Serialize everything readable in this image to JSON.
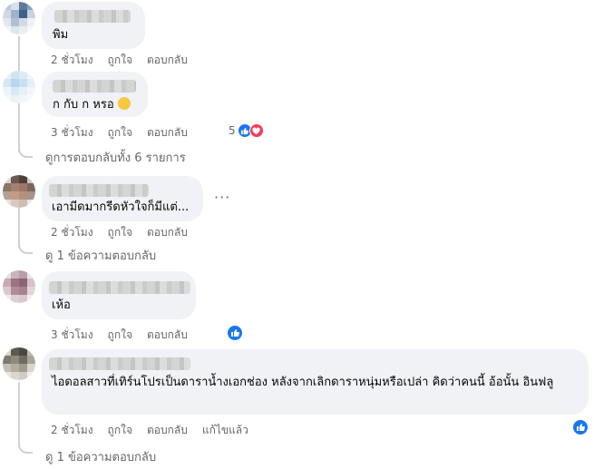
{
  "comments": [
    {
      "text": "พิม",
      "time": "2 ชั่วโมง",
      "like": "ถูกใจ",
      "reply": "ตอบกลับ"
    },
    {
      "text": "ก กับ ก หรอ",
      "time": "3 ชั่วโมง",
      "like": "ถูกใจ",
      "reply": "ตอบกลับ",
      "reaction_count": "5",
      "replies_link": "ดูการตอบกลับทั้ง 6 รายการ"
    },
    {
      "text": "เอามีดมากรีดหัวใจก็มีแต่...",
      "time": "2 ชั่วโมง",
      "like": "ถูกใจ",
      "reply": "ตอบกลับ",
      "more": "···",
      "replies_link": "ดู 1 ข้อความตอบกลับ"
    },
    {
      "text": "เห้อ",
      "time": "3 ชั่วโมง",
      "like": "ถูกใจ",
      "reply": "ตอบกลับ"
    },
    {
      "text": "ไอดอลสาวที่เทิร์นโปรเป็นดาราน้ำงเอกช่อง หลังจากเลิกดาราหนุ่มหรือเปล่า คิดว่าคนนี้ อ้อนั้น อินฟลู",
      "time": "2 ชั่วโมง",
      "like": "ถูกใจ",
      "reply": "ตอบกลับ",
      "edited": "แก้ไขแล้ว",
      "replies_link": "ดู 1 ข้อความตอบกลับ"
    }
  ],
  "colors": {
    "like": "#1877f2",
    "love": "#f33e58",
    "bubble": "#f0f2f5",
    "meta": "#65676b"
  }
}
